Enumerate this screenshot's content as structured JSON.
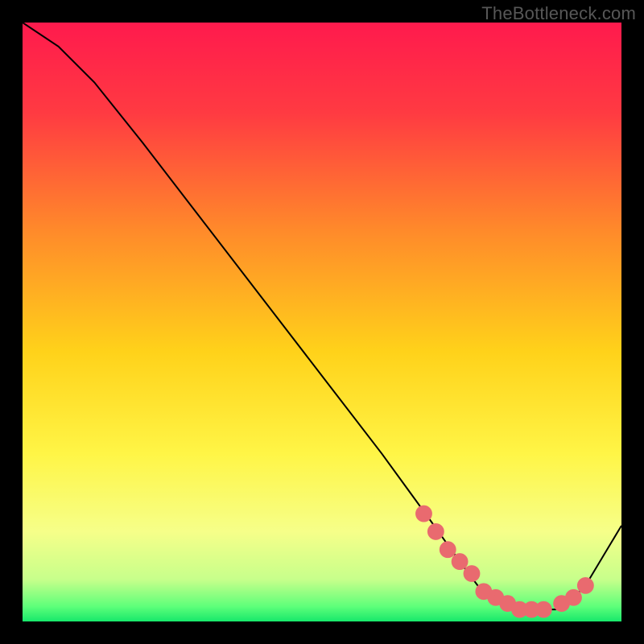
{
  "watermark": "TheBottleneck.com",
  "chart_data": {
    "type": "line",
    "title": "",
    "xlabel": "",
    "ylabel": "",
    "xlim": [
      0,
      100
    ],
    "ylim": [
      0,
      100
    ],
    "series": [
      {
        "name": "curve",
        "x": [
          0,
          6,
          12,
          20,
          30,
          40,
          50,
          60,
          68,
          73,
          76,
          80,
          84,
          87,
          89,
          91,
          94,
          97,
          100
        ],
        "values": [
          100,
          96,
          90,
          80,
          67,
          54,
          41,
          28,
          17,
          10,
          6,
          3,
          2,
          2,
          2,
          3,
          6,
          11,
          16
        ]
      }
    ],
    "markers": {
      "name": "highlight",
      "x": [
        67,
        69,
        71,
        73,
        75,
        77,
        79,
        81,
        83,
        85,
        87,
        90,
        92,
        94
      ],
      "values": [
        18,
        15,
        12,
        10,
        8,
        5,
        4,
        3,
        2,
        2,
        2,
        3,
        4,
        6
      ]
    },
    "gradient_stops": [
      {
        "offset": 0.0,
        "color": "#ff1a4d"
      },
      {
        "offset": 0.15,
        "color": "#ff3a42"
      },
      {
        "offset": 0.35,
        "color": "#ff8b2a"
      },
      {
        "offset": 0.55,
        "color": "#ffd21a"
      },
      {
        "offset": 0.72,
        "color": "#fff546"
      },
      {
        "offset": 0.85,
        "color": "#f6ff89"
      },
      {
        "offset": 0.93,
        "color": "#c7ff8b"
      },
      {
        "offset": 0.975,
        "color": "#5eff7a"
      },
      {
        "offset": 1.0,
        "color": "#17e86b"
      }
    ],
    "colors": {
      "curve_stroke": "#000000",
      "marker_fill": "#e96a6f",
      "marker_stroke": "#e96a6f"
    }
  }
}
